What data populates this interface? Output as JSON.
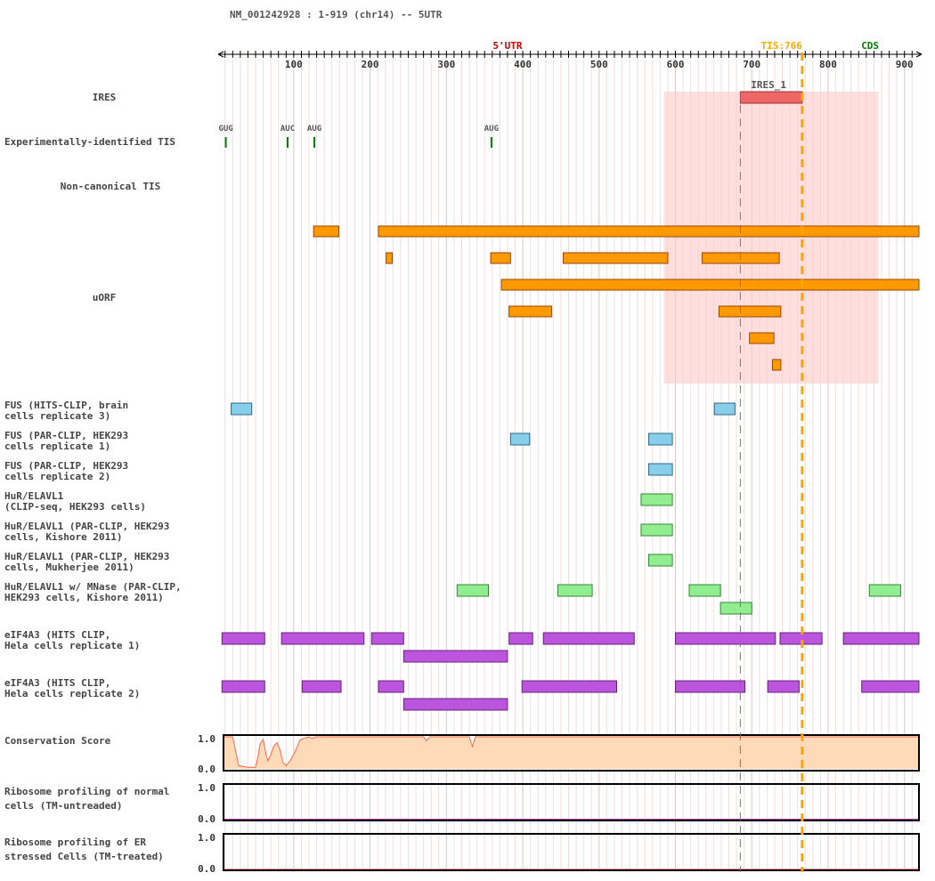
{
  "header": {
    "title": "NM_001242928 : 1-919 (chr14) -- 5UTR"
  },
  "colors": {
    "utr": "#cc0000",
    "tis": "#ffa500",
    "cds": "#008000",
    "ires": "#ee6666",
    "ires_region": "#ffcccc",
    "uorf": "#ff9900",
    "fus": "#87ceeb",
    "hur": "#90ee90",
    "eif": "#bb55dd",
    "conservation_fill": "#ffdab9",
    "conservation_line": "#ff6644",
    "ribo_line": "#aa44aa",
    "ribo_line_er": "#ff8888"
  },
  "labels": {
    "ires": "IRES",
    "exp_tis": "Experimentally-identified TIS",
    "noncanonical": "Non-canonical TIS",
    "uorf": "uORF",
    "fus_brain": [
      "FUS (HITS-CLIP, brain",
      "cells replicate 3)"
    ],
    "fus_hek1": [
      "FUS (PAR-CLIP, HEK293",
      "cells replicate 1)"
    ],
    "fus_hek2": [
      "FUS (PAR-CLIP, HEK293",
      "cells replicate 2)"
    ],
    "hur_clip": [
      "HuR/ELAVL1",
      "(CLIP-seq, HEK293 cells)"
    ],
    "hur_kishore": [
      "HuR/ELAVL1 (PAR-CLIP, HEK293",
      "cells, Kishore 2011)"
    ],
    "hur_mukherjee": [
      "HuR/ELAVL1 (PAR-CLIP, HEK293",
      "cells, Mukherjee 2011)"
    ],
    "hur_mnase": [
      "HuR/ELAVL1 w/ MNase (PAR-CLIP,",
      "HEK293 cells, Kishore 2011)"
    ],
    "eif_rep1": [
      "eIF4A3 (HITS CLIP,",
      "Hela cells replicate 1)"
    ],
    "eif_rep2": [
      "eIF4A3 (HITS CLIP,",
      "Hela cells replicate 2)"
    ],
    "conservation": "Conservation Score",
    "ribo_normal": [
      "Ribosome profiling of normal",
      "cells (TM-untreaded)"
    ],
    "ribo_er": [
      "Ribosome profiling of ER",
      "stressed Cells (TM-treated)"
    ]
  },
  "chart_data": {
    "type": "genome_track",
    "region": "NM_001242928 : 1-919 (chr14) -- 5UTR",
    "xlim": [
      1,
      919
    ],
    "x_ticks": [
      100,
      200,
      300,
      400,
      500,
      600,
      700,
      800,
      900
    ],
    "annotations": {
      "utr_label": "5'UTR",
      "utr_label_pos": 380,
      "tis_label": "TIS:766",
      "tis_pos": 766,
      "cds_label": "CDS",
      "cds_label_pos": 855,
      "dashed_line_pos": 685
    },
    "ires": {
      "name": "IRES_1",
      "start": 685,
      "end": 766,
      "region": [
        585,
        866
      ]
    },
    "experimental_tis": [
      {
        "codon": "GUG",
        "pos": 11
      },
      {
        "codon": "AUC",
        "pos": 92
      },
      {
        "codon": "AUG",
        "pos": 127
      },
      {
        "codon": "AUG",
        "pos": 359
      }
    ],
    "uorf": [
      {
        "start": 126,
        "end": 159,
        "row": 0
      },
      {
        "start": 211,
        "end": 919,
        "row": 0
      },
      {
        "start": 221,
        "end": 229,
        "row": 1
      },
      {
        "start": 358,
        "end": 384,
        "row": 1
      },
      {
        "start": 453,
        "end": 590,
        "row": 1
      },
      {
        "start": 635,
        "end": 736,
        "row": 1
      },
      {
        "start": 372,
        "end": 919,
        "row": 2
      },
      {
        "start": 382,
        "end": 438,
        "row": 3
      },
      {
        "start": 657,
        "end": 738,
        "row": 3
      },
      {
        "start": 697,
        "end": 729,
        "row": 4
      },
      {
        "start": 727,
        "end": 738,
        "row": 5
      }
    ],
    "fus_brain": [
      {
        "start": 18,
        "end": 45,
        "row": 0
      },
      {
        "start": 651,
        "end": 678,
        "row": 0
      }
    ],
    "fus_hek1": [
      {
        "start": 384,
        "end": 409,
        "row": 0
      },
      {
        "start": 565,
        "end": 596,
        "row": 0
      }
    ],
    "fus_hek2": [
      {
        "start": 565,
        "end": 596,
        "row": 0
      }
    ],
    "hur_clip": [
      {
        "start": 555,
        "end": 596,
        "row": 0
      }
    ],
    "hur_kishore": [
      {
        "start": 555,
        "end": 596,
        "row": 0
      }
    ],
    "hur_mukherjee": [
      {
        "start": 565,
        "end": 596,
        "row": 0
      }
    ],
    "hur_mnase": [
      {
        "start": 314,
        "end": 355,
        "row": 0
      },
      {
        "start": 446,
        "end": 491,
        "row": 0
      },
      {
        "start": 618,
        "end": 659,
        "row": 0
      },
      {
        "start": 854,
        "end": 895,
        "row": 0
      },
      {
        "start": 659,
        "end": 700,
        "row": 1
      }
    ],
    "eif_rep1": [
      {
        "start": 6,
        "end": 62,
        "row": 0
      },
      {
        "start": 84,
        "end": 192,
        "row": 0
      },
      {
        "start": 202,
        "end": 244,
        "row": 0
      },
      {
        "start": 382,
        "end": 413,
        "row": 0
      },
      {
        "start": 427,
        "end": 546,
        "row": 0
      },
      {
        "start": 600,
        "end": 731,
        "row": 0
      },
      {
        "start": 737,
        "end": 792,
        "row": 0
      },
      {
        "start": 820,
        "end": 919,
        "row": 0
      },
      {
        "start": 244,
        "end": 380,
        "row": 1
      }
    ],
    "eif_rep2": [
      {
        "start": 6,
        "end": 62,
        "row": 0
      },
      {
        "start": 111,
        "end": 162,
        "row": 0
      },
      {
        "start": 211,
        "end": 244,
        "row": 0
      },
      {
        "start": 399,
        "end": 523,
        "row": 0
      },
      {
        "start": 600,
        "end": 691,
        "row": 0
      },
      {
        "start": 721,
        "end": 762,
        "row": 0
      },
      {
        "start": 844,
        "end": 919,
        "row": 0
      },
      {
        "start": 244,
        "end": 380,
        "row": 1
      }
    ],
    "conservation": {
      "ylim": [
        0.0,
        1.0
      ],
      "y_ticks": [
        "1.0",
        "0.0"
      ],
      "points": [
        [
          1,
          1.0
        ],
        [
          20,
          1.0
        ],
        [
          24,
          0.55
        ],
        [
          28,
          0.1
        ],
        [
          40,
          0.05
        ],
        [
          50,
          0.05
        ],
        [
          52,
          0.25
        ],
        [
          56,
          0.78
        ],
        [
          60,
          0.92
        ],
        [
          63,
          0.55
        ],
        [
          66,
          0.25
        ],
        [
          70,
          0.45
        ],
        [
          74,
          0.72
        ],
        [
          78,
          0.82
        ],
        [
          82,
          0.6
        ],
        [
          86,
          0.2
        ],
        [
          90,
          0.1
        ],
        [
          96,
          0.28
        ],
        [
          102,
          0.55
        ],
        [
          108,
          0.9
        ],
        [
          114,
          0.96
        ],
        [
          120,
          1.0
        ],
        [
          124,
          0.95
        ],
        [
          130,
          1.0
        ],
        [
          270,
          1.0
        ],
        [
          274,
          0.88
        ],
        [
          278,
          1.0
        ],
        [
          320,
          1.0
        ],
        [
          330,
          1.0
        ],
        [
          334,
          0.7
        ],
        [
          338,
          1.0
        ],
        [
          919,
          1.0
        ]
      ]
    },
    "ribo_normal": {
      "ylim": [
        0.0,
        1.0
      ],
      "y_ticks": [
        "1.0",
        "0.0"
      ],
      "value": 0.0
    },
    "ribo_er": {
      "ylim": [
        0.0,
        1.0
      ],
      "y_ticks": [
        "1.0",
        "0.0"
      ],
      "value": 0.0
    }
  }
}
